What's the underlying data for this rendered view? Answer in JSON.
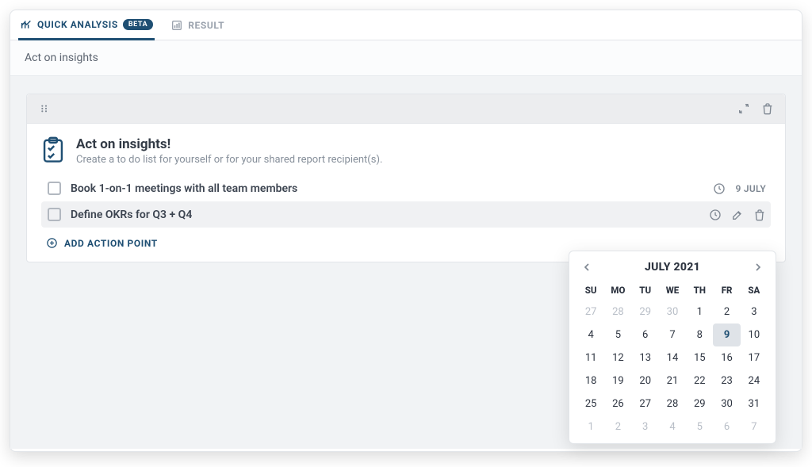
{
  "tabs": [
    {
      "label": "QUICK ANALYSIS",
      "badge": "BETA",
      "active": true
    },
    {
      "label": "RESULT",
      "active": false
    }
  ],
  "section_title": "Act on insights",
  "intro": {
    "title": "Act on insights!",
    "subtitle": "Create a to do list for yourself or for your shared report recipient(s)."
  },
  "actions": [
    {
      "label": "Book 1-on-1 meetings with all team members",
      "date": "9 JULY",
      "active": false
    },
    {
      "label": "Define OKRs for Q3 + Q4",
      "active": true
    }
  ],
  "add_action_label": "ADD ACTION POINT",
  "calendar": {
    "title": "JULY 2021",
    "dow": [
      "SU",
      "MO",
      "TU",
      "WE",
      "TH",
      "FR",
      "SA"
    ],
    "days": [
      {
        "n": 27,
        "t": "prev"
      },
      {
        "n": 28,
        "t": "prev"
      },
      {
        "n": 29,
        "t": "prev"
      },
      {
        "n": 30,
        "t": "prev"
      },
      {
        "n": 1,
        "t": ""
      },
      {
        "n": 2,
        "t": ""
      },
      {
        "n": 3,
        "t": ""
      },
      {
        "n": 4,
        "t": ""
      },
      {
        "n": 5,
        "t": ""
      },
      {
        "n": 6,
        "t": ""
      },
      {
        "n": 7,
        "t": ""
      },
      {
        "n": 8,
        "t": ""
      },
      {
        "n": 9,
        "t": "selected"
      },
      {
        "n": 10,
        "t": ""
      },
      {
        "n": 11,
        "t": ""
      },
      {
        "n": 12,
        "t": ""
      },
      {
        "n": 13,
        "t": ""
      },
      {
        "n": 14,
        "t": ""
      },
      {
        "n": 15,
        "t": ""
      },
      {
        "n": 16,
        "t": ""
      },
      {
        "n": 17,
        "t": ""
      },
      {
        "n": 18,
        "t": ""
      },
      {
        "n": 19,
        "t": ""
      },
      {
        "n": 20,
        "t": ""
      },
      {
        "n": 21,
        "t": ""
      },
      {
        "n": 22,
        "t": ""
      },
      {
        "n": 23,
        "t": ""
      },
      {
        "n": 24,
        "t": ""
      },
      {
        "n": 25,
        "t": ""
      },
      {
        "n": 26,
        "t": ""
      },
      {
        "n": 27,
        "t": ""
      },
      {
        "n": 28,
        "t": ""
      },
      {
        "n": 29,
        "t": ""
      },
      {
        "n": 30,
        "t": ""
      },
      {
        "n": 31,
        "t": ""
      },
      {
        "n": 1,
        "t": "next"
      },
      {
        "n": 2,
        "t": "next"
      },
      {
        "n": 3,
        "t": "next"
      },
      {
        "n": 4,
        "t": "next"
      },
      {
        "n": 5,
        "t": "next"
      },
      {
        "n": 6,
        "t": "next"
      },
      {
        "n": 7,
        "t": "next"
      }
    ]
  }
}
